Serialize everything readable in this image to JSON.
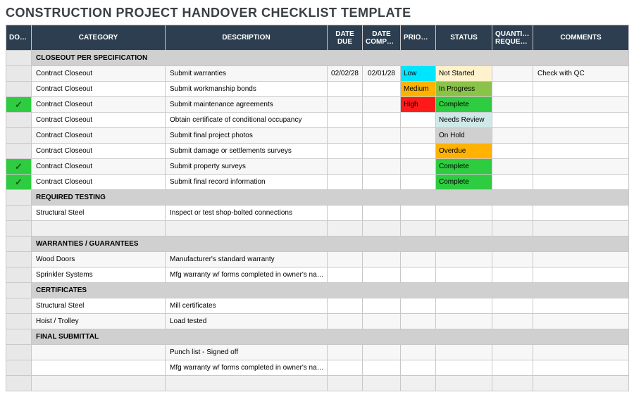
{
  "title": "CONSTRUCTION PROJECT HANDOVER CHECKLIST TEMPLATE",
  "headers": {
    "done": "DONE",
    "category": "CATEGORY",
    "description": "DESCRIPTION",
    "date_due": "DATE DUE",
    "date_completed": "DATE COMPLETED",
    "priority": "PRIORITY",
    "status": "STATUS",
    "qty": "QUANTITY REQUESTED",
    "comments": "COMMENTS"
  },
  "sections": [
    {
      "name": "CLOSEOUT PER SPECIFICATION",
      "rows": [
        {
          "done": false,
          "category": "Contract Closeout",
          "description": "Submit warranties",
          "date_due": "02/02/28",
          "date_completed": "02/01/28",
          "priority": "Low",
          "priority_class": "prio-low",
          "status": "Not Started",
          "status_class": "stat-notstarted",
          "qty": "",
          "comments": "Check with QC"
        },
        {
          "done": false,
          "category": "Contract Closeout",
          "description": "Submit workmanship bonds",
          "date_due": "",
          "date_completed": "",
          "priority": "Medium",
          "priority_class": "prio-med",
          "status": "In Progress",
          "status_class": "stat-inprogress",
          "qty": "",
          "comments": ""
        },
        {
          "done": true,
          "category": "Contract Closeout",
          "description": "Submit maintenance agreements",
          "date_due": "",
          "date_completed": "",
          "priority": "High",
          "priority_class": "prio-high",
          "status": "Complete",
          "status_class": "stat-complete",
          "qty": "",
          "comments": ""
        },
        {
          "done": false,
          "category": "Contract Closeout",
          "description": "Obtain certificate of conditional occupancy",
          "date_due": "",
          "date_completed": "",
          "priority": "",
          "priority_class": "",
          "status": "Needs Review",
          "status_class": "stat-needsreview",
          "qty": "",
          "comments": ""
        },
        {
          "done": false,
          "category": "Contract Closeout",
          "description": "Submit final project photos",
          "date_due": "",
          "date_completed": "",
          "priority": "",
          "priority_class": "",
          "status": "On Hold",
          "status_class": "stat-onhold",
          "qty": "",
          "comments": ""
        },
        {
          "done": false,
          "category": "Contract Closeout",
          "description": "Submit damage or settlements surveys",
          "date_due": "",
          "date_completed": "",
          "priority": "",
          "priority_class": "",
          "status": "Overdue",
          "status_class": "stat-overdue",
          "qty": "",
          "comments": ""
        },
        {
          "done": true,
          "category": "Contract Closeout",
          "description": "Submit property surveys",
          "date_due": "",
          "date_completed": "",
          "priority": "",
          "priority_class": "",
          "status": "Complete",
          "status_class": "stat-complete",
          "qty": "",
          "comments": ""
        },
        {
          "done": true,
          "category": "Contract Closeout",
          "description": "Submit final record information",
          "date_due": "",
          "date_completed": "",
          "priority": "",
          "priority_class": "",
          "status": "Complete",
          "status_class": "stat-complete",
          "qty": "",
          "comments": ""
        }
      ],
      "trailing_empty": 0
    },
    {
      "name": "REQUIRED TESTING",
      "rows": [
        {
          "done": false,
          "category": "Structural Steel",
          "description": "Inspect or test shop-bolted connections",
          "date_due": "",
          "date_completed": "",
          "priority": "",
          "priority_class": "",
          "status": "",
          "status_class": "",
          "qty": "",
          "comments": ""
        }
      ],
      "trailing_empty": 1
    },
    {
      "name": "WARRANTIES / GUARANTEES",
      "rows": [
        {
          "done": false,
          "category": "Wood Doors",
          "description": "Manufacturer's standard warranty",
          "date_due": "",
          "date_completed": "",
          "priority": "",
          "priority_class": "",
          "status": "",
          "status_class": "",
          "qty": "",
          "comments": ""
        },
        {
          "done": false,
          "category": "Sprinkler Systems",
          "description": "Mfg warranty w/ forms completed in owner's name",
          "date_due": "",
          "date_completed": "",
          "priority": "",
          "priority_class": "",
          "status": "",
          "status_class": "",
          "qty": "",
          "comments": ""
        }
      ],
      "trailing_empty": 0
    },
    {
      "name": "CERTIFICATES",
      "rows": [
        {
          "done": false,
          "category": "Structural Steel",
          "description": "Mill certificates",
          "date_due": "",
          "date_completed": "",
          "priority": "",
          "priority_class": "",
          "status": "",
          "status_class": "",
          "qty": "",
          "comments": ""
        },
        {
          "done": false,
          "category": "Hoist / Trolley",
          "description": "Load tested",
          "date_due": "",
          "date_completed": "",
          "priority": "",
          "priority_class": "",
          "status": "",
          "status_class": "",
          "qty": "",
          "comments": ""
        }
      ],
      "trailing_empty": 0
    },
    {
      "name": "FINAL SUBMITTAL",
      "rows": [
        {
          "done": false,
          "category": "",
          "description": "Punch list - Signed off",
          "date_due": "",
          "date_completed": "",
          "priority": "",
          "priority_class": "",
          "status": "",
          "status_class": "",
          "qty": "",
          "comments": ""
        },
        {
          "done": false,
          "category": "",
          "description": "Mfg warranty w/ forms completed in owner's name",
          "date_due": "",
          "date_completed": "",
          "priority": "",
          "priority_class": "",
          "status": "",
          "status_class": "",
          "qty": "",
          "comments": ""
        }
      ],
      "trailing_empty": 1
    }
  ]
}
